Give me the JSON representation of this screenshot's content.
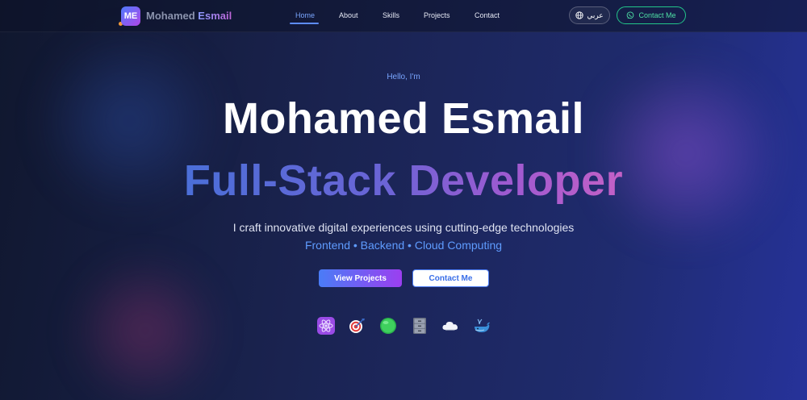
{
  "navbar": {
    "logo_badge": "ME",
    "logo_first": "Mohamed",
    "logo_last": "Esmail",
    "links": [
      {
        "label": "Home",
        "active": true
      },
      {
        "label": "About",
        "active": false
      },
      {
        "label": "Skills",
        "active": false
      },
      {
        "label": "Projects",
        "active": false
      },
      {
        "label": "Contact",
        "active": false
      }
    ],
    "lang_label": "عربي",
    "lang_icon": "globe-icon",
    "contact_label": "Contact Me",
    "contact_icon": "whatsapp-icon"
  },
  "hero": {
    "greeting": "Hello, I'm",
    "name": "Mohamed Esmail",
    "role": "Full-Stack Developer",
    "description": "I craft innovative digital experiences using cutting-edge technologies",
    "stack": "Frontend • Backend • Cloud Computing",
    "primary_button": "View Projects",
    "secondary_button": "Contact Me"
  },
  "tech_icons": [
    "react-icon",
    "target-icon",
    "green-circle-icon",
    "file-cabinet-icon",
    "cloud-icon",
    "whale-icon"
  ],
  "colors": {
    "accent_blue": "#5d8cff",
    "accent_purple": "#9b3ff0",
    "whatsapp_green": "#22c58a"
  }
}
